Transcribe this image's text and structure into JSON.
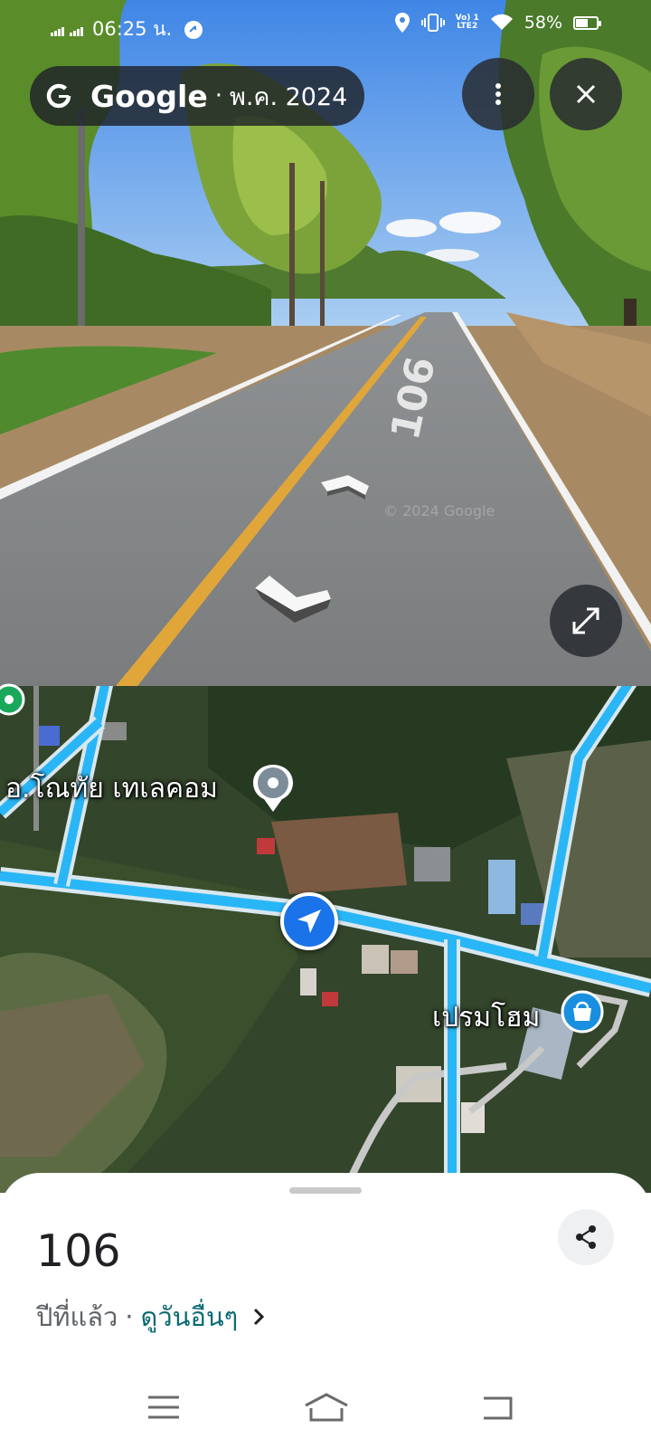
{
  "status_bar": {
    "time": "06:25 น.",
    "battery": "58%",
    "battery_level": 0.58,
    "network_label_1": "Vo) 1",
    "network_label_2": "LTE2"
  },
  "street_view": {
    "brand": "Google",
    "separator": "·",
    "capture_date": "พ.ค. 2024",
    "road_marking": "106",
    "watermark": "© 2024 Google"
  },
  "map": {
    "labels": {
      "telecom": "อ.โณทัย เทเลคอม",
      "store": "เปรมโฮม"
    },
    "colors": {
      "road": "#29b6f6",
      "road_casing": "#d9e7ee",
      "nav_arrow": "#1a73e8"
    }
  },
  "sheet": {
    "title": "106",
    "time_ago": "ปีที่แล้ว",
    "separator": "·",
    "more_dates_link": "ดูวันอื่นๆ",
    "link_color": "#0b6b73"
  },
  "icons": {
    "google": "google-g-icon",
    "more": "more-vert-icon",
    "close": "close-icon",
    "expand": "expand-icon",
    "share": "share-icon",
    "menu": "menu-icon",
    "home": "home-icon",
    "back": "back-icon"
  }
}
